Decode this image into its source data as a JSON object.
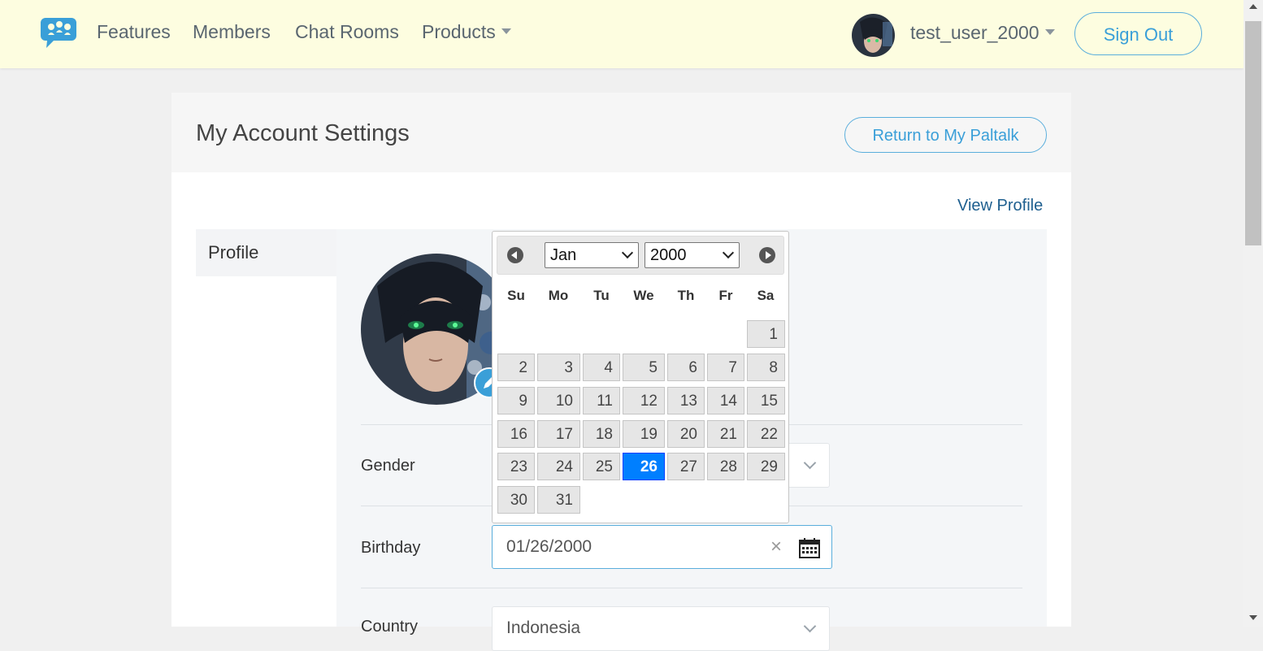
{
  "nav": {
    "links": [
      "Features",
      "Members",
      "Chat Rooms",
      "Products"
    ],
    "username": "test_user_2000",
    "signout_label": "Sign Out"
  },
  "page": {
    "title": "My Account Settings",
    "return_label": "Return to My Paltalk",
    "view_profile_label": "View Profile",
    "tab_profile": "Profile"
  },
  "form": {
    "gender_label": "Gender",
    "birthday_label": "Birthday",
    "birthday_value": "01/26/2000",
    "country_label": "Country",
    "country_value": "Indonesia"
  },
  "datepicker": {
    "month": "Jan",
    "year": "2000",
    "weekdays": [
      "Su",
      "Mo",
      "Tu",
      "We",
      "Th",
      "Fr",
      "Sa"
    ],
    "first_weekday_index": 6,
    "days_in_month": 31,
    "selected_day": 26
  },
  "colors": {
    "accent": "#3a9fd8",
    "selected_day": "#007fff",
    "nav_bg": "#fdfde0"
  },
  "icons": {
    "logo": "paltalk-chat-bubbles-logo",
    "edit": "pencil-icon",
    "calendar": "calendar-icon",
    "clear": "close-icon"
  }
}
